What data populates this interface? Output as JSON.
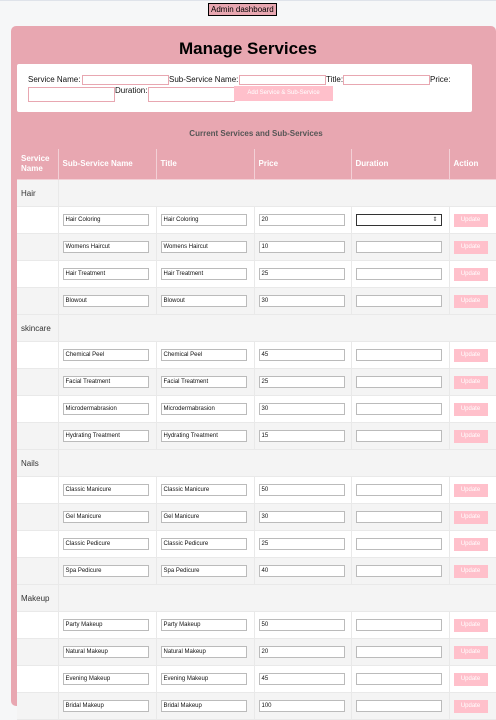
{
  "header": {
    "admin_button": "Admin dashboard"
  },
  "page": {
    "title": "Manage Services"
  },
  "form": {
    "service_label": "Service Name:",
    "subservice_label": "Sub-Service Name:",
    "title_label": "Title:",
    "price_label": "Price:",
    "duration_label": "Duration:",
    "add_button": "Add Service & Sub-Service"
  },
  "section_title": "Current Services and Sub-Services",
  "table": {
    "columns": [
      "Service Name",
      "Sub-Service Name",
      "Title",
      "Price",
      "Duration",
      "Action"
    ],
    "update_label": "Update",
    "spinner": "⇕",
    "groups": [
      {
        "service": "Hair",
        "rows": [
          {
            "sub": "Hair Coloring",
            "title": "Hair Coloring",
            "price": "20"
          },
          {
            "sub": "Womens Haircut",
            "title": "Womens Haircut",
            "price": "10"
          },
          {
            "sub": "Hair Treatment",
            "title": "Hair Treatment",
            "price": "25"
          },
          {
            "sub": "Blowout",
            "title": "Blowout",
            "price": "30"
          }
        ]
      },
      {
        "service": "skincare",
        "rows": [
          {
            "sub": "Chemical Peel",
            "title": "Chemical Peel",
            "price": "45"
          },
          {
            "sub": "Facial Treatment",
            "title": "Facial Treatment",
            "price": "25"
          },
          {
            "sub": "Microdermabrasion",
            "title": "Microdermabrasion",
            "price": "30"
          },
          {
            "sub": "Hydrating Treatment",
            "title": "Hydrating Treatment",
            "price": "15"
          }
        ]
      },
      {
        "service": "Nails",
        "rows": [
          {
            "sub": "Classic Manicure",
            "title": "Classic Manicure",
            "price": "50"
          },
          {
            "sub": "Gel Manicure",
            "title": "Gel Manicure",
            "price": "30"
          },
          {
            "sub": "Classic Pedicure",
            "title": "Classic Pedicure",
            "price": "25"
          },
          {
            "sub": "Spa Pedicure",
            "title": "Spa Pedicure",
            "price": "40"
          }
        ]
      },
      {
        "service": "Makeup",
        "rows": [
          {
            "sub": "Party Makeup",
            "title": "Party Makeup",
            "price": "50"
          },
          {
            "sub": "Natural Makeup",
            "title": "Natural Makeup",
            "price": "20"
          },
          {
            "sub": "Evening Makeup",
            "title": "Evening Makeup",
            "price": "45"
          },
          {
            "sub": "Bridal Makeup",
            "title": "Bridal Makeup",
            "price": "100"
          }
        ]
      }
    ]
  }
}
